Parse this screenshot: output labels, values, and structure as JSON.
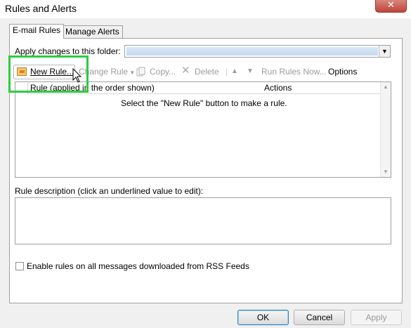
{
  "window": {
    "title": "Rules and Alerts",
    "close_glyph": "✕"
  },
  "tabs": [
    {
      "label": "E-mail Rules",
      "active": true
    },
    {
      "label": "Manage Alerts",
      "active": false
    }
  ],
  "folder": {
    "label": "Apply changes to this folder:",
    "value": ""
  },
  "toolbar": {
    "new_rule": "New Rule...",
    "change_rule": "Change Rule",
    "copy": "Copy...",
    "delete": "Delete",
    "run_rules": "Run Rules Now...",
    "options": "Options"
  },
  "table": {
    "columns": [
      "Rule (applied in the order shown)",
      "Actions"
    ],
    "empty_message": "Select the \"New Rule\" button to make a rule."
  },
  "description": {
    "label": "Rule description (click an underlined value to edit):"
  },
  "rss": {
    "label": "Enable rules on all messages downloaded from RSS Feeds",
    "checked": false
  },
  "buttons": {
    "ok": "OK",
    "cancel": "Cancel",
    "apply": "Apply"
  },
  "colors": {
    "highlight": "#2ecc40",
    "close": "#c0443a"
  },
  "icons": [
    "new-rule-icon",
    "change-rule-icon",
    "copy-icon",
    "delete-icon",
    "move-up-icon",
    "move-down-icon",
    "close-icon"
  ]
}
